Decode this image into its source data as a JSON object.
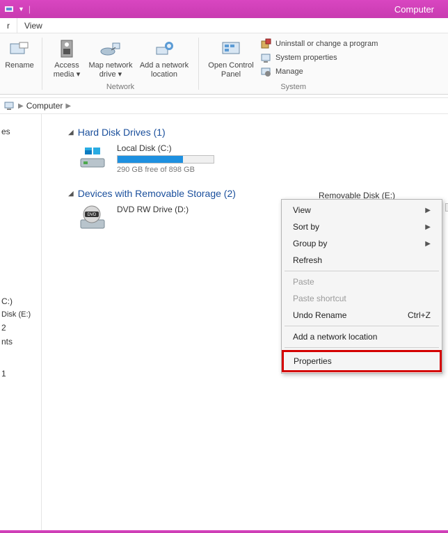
{
  "titlebar": {
    "title": "Computer"
  },
  "menubar": {
    "left": "r",
    "view": "View"
  },
  "ribbon": {
    "rename": "Rename",
    "access": "Access\nmedia ▾",
    "mapdrive": "Map network\ndrive ▾",
    "addloc": "Add a network\nlocation",
    "network_group": "Network",
    "openctrl": "Open Control\nPanel",
    "uninstall": "Uninstall or change a program",
    "sysprops": "System properties",
    "manage": "Manage",
    "system_group": "System"
  },
  "breadcrumb": {
    "computer": "Computer"
  },
  "sidebar": {
    "es": "es",
    "c": "C:)",
    "e": "Disk (E:)",
    "two": "2",
    "nts": "nts",
    "one": "1"
  },
  "categories": {
    "hdd": "Hard Disk Drives (1)",
    "removable": "Devices with Removable Storage (2)"
  },
  "drives": {
    "localc": {
      "name": "Local Disk (C:)",
      "free": "290 GB free of 898 GB",
      "fill_pct": 68
    },
    "dvd": {
      "name": "DVD RW Drive (D:)"
    },
    "remE": {
      "name": "Removable Disk (E:)"
    }
  },
  "ctx": {
    "view": "View",
    "sortby": "Sort by",
    "groupby": "Group by",
    "refresh": "Refresh",
    "paste": "Paste",
    "paste_shortcut": "Paste shortcut",
    "undo_rename": "Undo Rename",
    "undo_shortcut": "Ctrl+Z",
    "addnet": "Add a network location",
    "properties": "Properties"
  }
}
